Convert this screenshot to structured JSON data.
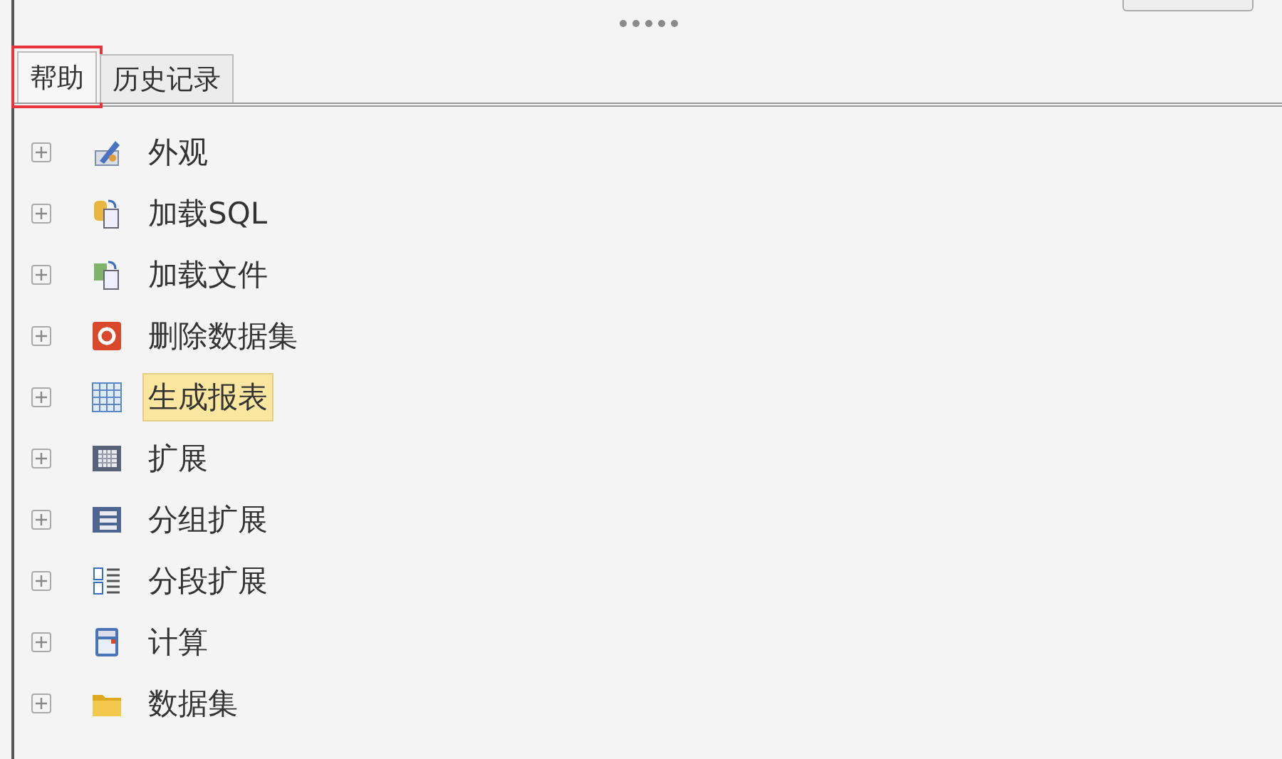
{
  "tabs": [
    {
      "label": "帮助",
      "selected": true,
      "highlighted": true
    },
    {
      "label": "历史记录",
      "selected": false,
      "highlighted": false
    }
  ],
  "tree": [
    {
      "label": "外观",
      "kind": "appearance",
      "expanded": false,
      "selected": false
    },
    {
      "label": "加载SQL",
      "kind": "sql",
      "expanded": false,
      "selected": false
    },
    {
      "label": "加载文件",
      "kind": "file",
      "expanded": false,
      "selected": false
    },
    {
      "label": "删除数据集",
      "kind": "delete",
      "expanded": false,
      "selected": false
    },
    {
      "label": "生成报表",
      "kind": "grid",
      "expanded": false,
      "selected": true
    },
    {
      "label": "扩展",
      "kind": "table",
      "expanded": false,
      "selected": false
    },
    {
      "label": "分组扩展",
      "kind": "group",
      "expanded": false,
      "selected": false
    },
    {
      "label": "分段扩展",
      "kind": "segment",
      "expanded": false,
      "selected": false
    },
    {
      "label": "计算",
      "kind": "calc",
      "expanded": false,
      "selected": false
    },
    {
      "label": "数据集",
      "kind": "folder",
      "expanded": false,
      "selected": false
    }
  ]
}
